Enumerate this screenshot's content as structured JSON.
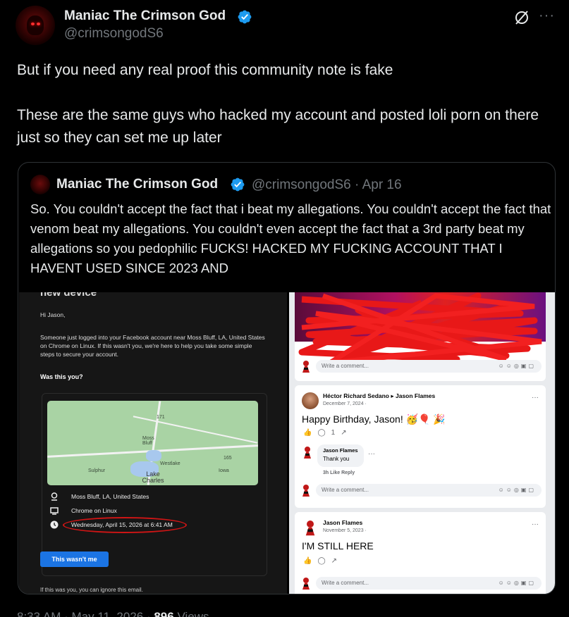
{
  "tweet": {
    "author_name": "Maniac The Crimson God",
    "author_handle": "@crimsongodS6",
    "text_line1": "But if you need any real proof this community note is fake",
    "text_line2": "These are the same guys who hacked my account and posted loli porn on there just so they can set me up later",
    "more_label": "···"
  },
  "quote": {
    "author_name": "Maniac The Crimson God",
    "handle_date": "@crimsongodS6 · Apr 16",
    "text": "So. You couldn't accept the fact that i beat my allegations. You couldn't accept the fact that venom beat my allegations. You couldn't even accept the fact that a 3rd party beat my allegations so you pedophilic FUCKS! HACKED MY FUCKING ACCOUNT THAT I HAVENT USED SINCE 2023 AND"
  },
  "facebook_email": {
    "title": "new device",
    "greeting": "Hi Jason,",
    "paragraph": "Someone just logged into your Facebook account near Moss Bluff, LA, United States on Chrome on Linux. If this wasn't you, we're here to help you take some simple steps to secure your account.",
    "question": "Was this you?",
    "map_labels": {
      "road1": "171",
      "road2": "165",
      "town1": "Moss Bluff",
      "town2": "Westlake",
      "town3": "Sulphur",
      "town4": "Iowa",
      "city": "Lake Charles"
    },
    "location": "Moss Bluff, LA, United States",
    "browser": "Chrome on Linux",
    "datetime": "Wednesday, April 15, 2026 at 6:41 AM",
    "button": "This wasn't me",
    "footer": "If this was you, you can ignore this email."
  },
  "facebook_feed": {
    "comment_placeholder": "Write a comment...",
    "post1": {
      "author": "Héctor Richard Sedano ▸ Jason Flames",
      "date": "December 7, 2024 · ",
      "body": "Happy Birthday, Jason! 🥳🎈 🎉",
      "react_count": "1",
      "reply_author": "Jason Flames",
      "reply_text": "Thank you",
      "reply_meta": "3h   Like   Reply"
    },
    "post2": {
      "author": "Jason Flames",
      "date": "November 5, 2023 · ",
      "body": "I'M STILL HERE"
    }
  },
  "footer": {
    "time": "8:33 AM · May 11, 2026 · ",
    "views_count": "896",
    "views_label": " Views"
  },
  "colors": {
    "background": "#000000",
    "verified_blue": "#1d9bf0",
    "muted": "#71767b",
    "fb_blue": "#1b74e4",
    "scribble_red": "#e81818"
  }
}
